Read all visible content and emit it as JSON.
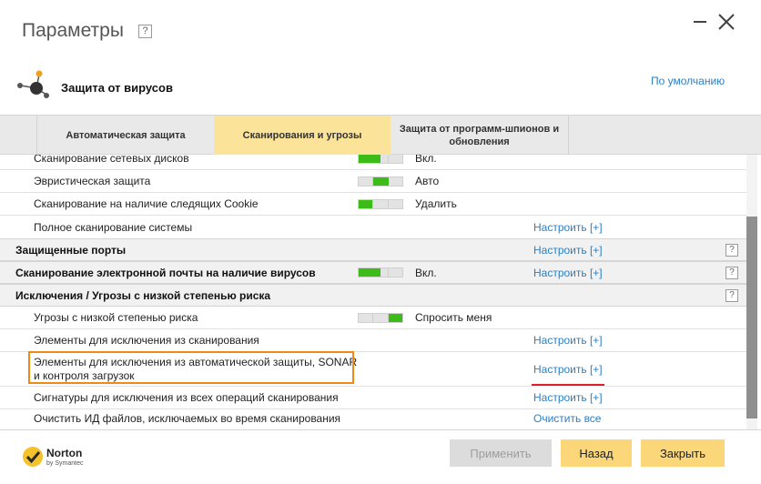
{
  "window": {
    "title": "Параметры",
    "help": "?"
  },
  "section": {
    "title": "Защита от вирусов",
    "default_link": "По умолчанию"
  },
  "tabs": [
    {
      "label": "Автоматическая защита"
    },
    {
      "label": "Сканирования и угрозы"
    },
    {
      "label": "Защита от программ-шпионов и обновления"
    }
  ],
  "rows": [
    {
      "label": "Сканирование сетевых дисков",
      "value": "Вкл."
    },
    {
      "label": "Эвристическая защита",
      "value": "Авто"
    },
    {
      "label": "Сканирование на наличие следящих Cookie",
      "value": "Удалить"
    },
    {
      "label": "Полное сканирование системы",
      "link": "Настроить [+]"
    },
    {
      "label": "Защищенные порты",
      "link": "Настроить [+]",
      "help": "?"
    },
    {
      "label": "Сканирование электронной почты на наличие вирусов",
      "value": "Вкл.",
      "link": "Настроить [+]",
      "help": "?"
    },
    {
      "label": "Исключения / Угрозы с низкой степенью риска",
      "help": "?"
    },
    {
      "label": "Угрозы с низкой степенью риска",
      "value": "Спросить меня"
    },
    {
      "label": "Элементы для исключения из сканирования",
      "link": "Настроить [+]"
    },
    {
      "label_line1": "Элементы для исключения из автоматической защиты, SONAR",
      "label_line2": "и контроля загрузок",
      "link": "Настроить [+]"
    },
    {
      "label": "Сигнатуры для исключения из всех операций сканирования",
      "link": "Настроить [+]"
    },
    {
      "label": "Очистить ИД файлов, исключаемых во время сканирования",
      "link": "Очистить все"
    }
  ],
  "buttons": {
    "apply": "Применить",
    "back": "Назад",
    "close": "Закрыть"
  },
  "logo": {
    "brand": "Norton",
    "by": "by Symantec"
  },
  "colors": {
    "accent_tab": "#fbe49a",
    "toggle_green": "#3dbb18",
    "link": "#2b7fc4",
    "button": "#fbd77a",
    "highlight": "#f08a17",
    "underline": "#d8222a"
  }
}
